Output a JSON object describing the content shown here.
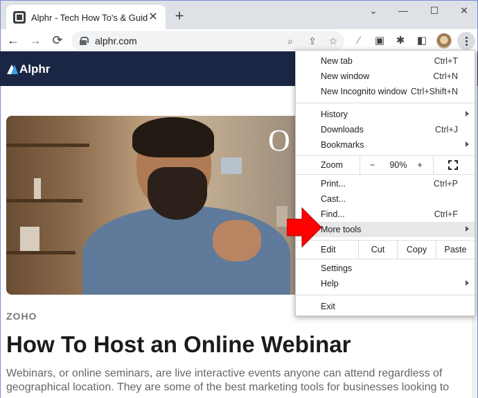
{
  "tab": {
    "title": "Alphr - Tech How To's & Guides",
    "close_glyph": "✕"
  },
  "newtab_glyph": "+",
  "window": {
    "minimize": "⌄",
    "restore": "—",
    "maximize": "☐",
    "close": "✕"
  },
  "toolbar": {
    "back": "←",
    "forward": "→",
    "reload": "⟳",
    "url": "alphr.com"
  },
  "omnibox_icons": [
    "zoom-icon",
    "share-icon",
    "bookmark-star-icon"
  ],
  "extensions": [
    "feather-extension-icon",
    "screenshot-extension-icon",
    "puzzle-extensions-icon",
    "side-panel-icon"
  ],
  "site": {
    "logo": "Alphr",
    "hero_word": "O"
  },
  "article": {
    "brand": "ZOHO",
    "title": "How To Host an Online Webinar",
    "body": "Webinars, or online seminars, are live interactive events anyone can attend regardless of geographical location. They are some of the best marketing tools for businesses looking to"
  },
  "menu": {
    "new_tab": {
      "label": "New tab",
      "shortcut": "Ctrl+T"
    },
    "new_window": {
      "label": "New window",
      "shortcut": "Ctrl+N"
    },
    "new_incognito": {
      "label": "New Incognito window",
      "shortcut": "Ctrl+Shift+N"
    },
    "history": {
      "label": "History"
    },
    "downloads": {
      "label": "Downloads",
      "shortcut": "Ctrl+J"
    },
    "bookmarks": {
      "label": "Bookmarks"
    },
    "zoom": {
      "label": "Zoom",
      "minus": "−",
      "value": "90%",
      "plus": "+"
    },
    "print": {
      "label": "Print...",
      "shortcut": "Ctrl+P"
    },
    "cast": {
      "label": "Cast..."
    },
    "find": {
      "label": "Find...",
      "shortcut": "Ctrl+F"
    },
    "more_tools": {
      "label": "More tools"
    },
    "edit": {
      "label": "Edit",
      "cut": "Cut",
      "copy": "Copy",
      "paste": "Paste"
    },
    "settings": {
      "label": "Settings"
    },
    "help": {
      "label": "Help"
    },
    "exit": {
      "label": "Exit"
    }
  },
  "colors": {
    "site_header": "#1a2644",
    "highlight": "#e8e8e8",
    "arrow": "#ff0000"
  }
}
